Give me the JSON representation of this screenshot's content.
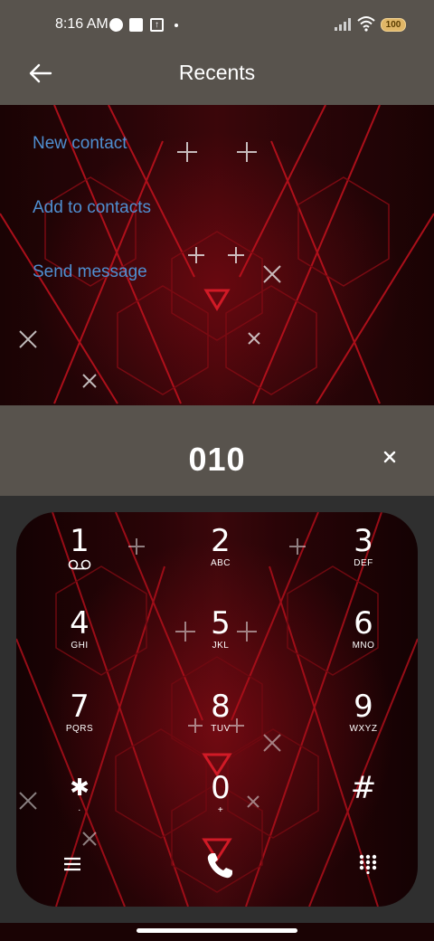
{
  "status_bar": {
    "time": "8:16 AM",
    "battery": "100"
  },
  "app_bar": {
    "title": "Recents"
  },
  "menu": {
    "new_contact": "New contact",
    "add_to_contacts": "Add to contacts",
    "send_message": "Send message"
  },
  "dialer": {
    "digits": "010",
    "keys": [
      {
        "num": "1",
        "sub": ""
      },
      {
        "num": "2",
        "sub": "ABC"
      },
      {
        "num": "3",
        "sub": "DEF"
      },
      {
        "num": "4",
        "sub": "GHI"
      },
      {
        "num": "5",
        "sub": "JKL"
      },
      {
        "num": "6",
        "sub": "MNO"
      },
      {
        "num": "7",
        "sub": "PQRS"
      },
      {
        "num": "8",
        "sub": "TUV"
      },
      {
        "num": "9",
        "sub": "WXYZ"
      },
      {
        "num": "✱",
        "sub": "·"
      },
      {
        "num": "0",
        "sub": "+"
      },
      {
        "num": "#",
        "sub": ""
      }
    ]
  },
  "icons": {
    "back": "back-arrow-icon",
    "clear": "close-icon",
    "voicemail": "voicemail-icon",
    "menu": "hamburger-menu-icon",
    "call": "phone-call-icon",
    "keypad": "dialpad-icon"
  },
  "colors": {
    "link": "#4f8fd1",
    "app_bar": "#58534d",
    "call_button": "#ffffff"
  }
}
